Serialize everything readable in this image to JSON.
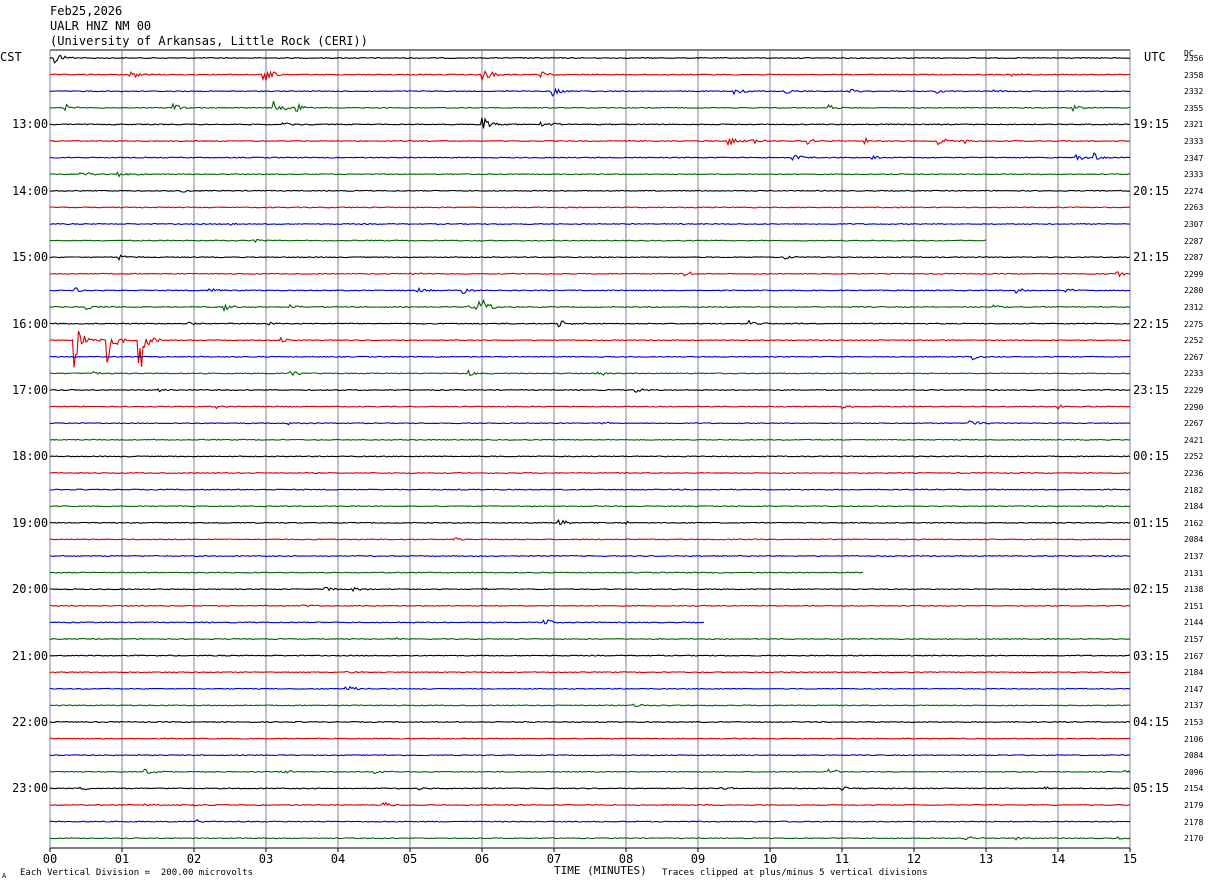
{
  "header": {
    "date": "Feb25,2026",
    "station": "UALR HNZ NM 00",
    "institution": "(University of Arkansas, Little Rock (CERI))"
  },
  "left_zone": "CST",
  "right_zone": "UTC",
  "dc_label": "DC",
  "footer": {
    "left": "Each Vertical Division =  200.00 microvolts",
    "center": "TIME (MINUTES)",
    "right": "Traces clipped at plus/minus 5 vertical divisions",
    "corner": "A"
  },
  "chart_data": {
    "type": "line",
    "title": "UALR HNZ NM 00",
    "xlabel": "TIME (MINUTES)",
    "ylabel": "",
    "xlim": [
      0,
      15
    ],
    "x_ticks": [
      "00",
      "01",
      "02",
      "03",
      "04",
      "05",
      "06",
      "07",
      "08",
      "09",
      "10",
      "11",
      "12",
      "13",
      "14",
      "15"
    ],
    "trace_minutes": 15,
    "trace_colors": [
      "#000000",
      "#d40000",
      "#0000c8",
      "#006400"
    ],
    "grid": true,
    "left_hour_labels": [
      {
        "row": 4,
        "label": "13:00"
      },
      {
        "row": 8,
        "label": "14:00"
      },
      {
        "row": 12,
        "label": "15:00"
      },
      {
        "row": 16,
        "label": "16:00"
      },
      {
        "row": 20,
        "label": "17:00"
      },
      {
        "row": 24,
        "label": "18:00"
      },
      {
        "row": 28,
        "label": "19:00"
      },
      {
        "row": 32,
        "label": "20:00"
      },
      {
        "row": 36,
        "label": "21:00"
      },
      {
        "row": 40,
        "label": "22:00"
      },
      {
        "row": 44,
        "label": "23:00"
      }
    ],
    "right_hour_labels": [
      {
        "row": 4,
        "label": "19:15"
      },
      {
        "row": 8,
        "label": "20:15"
      },
      {
        "row": 12,
        "label": "21:15"
      },
      {
        "row": 16,
        "label": "22:15"
      },
      {
        "row": 20,
        "label": "23:15"
      },
      {
        "row": 24,
        "label": "00:15"
      },
      {
        "row": 28,
        "label": "01:15"
      },
      {
        "row": 32,
        "label": "02:15"
      },
      {
        "row": 36,
        "label": "03:15"
      },
      {
        "row": 40,
        "label": "04:15"
      },
      {
        "row": 44,
        "label": "05:15"
      }
    ],
    "dc_values": [
      2356,
      2358,
      2332,
      2355,
      2321,
      2333,
      2347,
      2333,
      2274,
      2263,
      2307,
      2287,
      2287,
      2299,
      2280,
      2312,
      2275,
      2252,
      2267,
      2233,
      2229,
      2290,
      2267,
      2421,
      2252,
      2236,
      2182,
      2184,
      2162,
      2084,
      2137,
      2131,
      2138,
      2151,
      2144,
      2157,
      2167,
      2184,
      2147,
      2137,
      2153,
      2106,
      2084,
      2096,
      2154,
      2179,
      2178,
      2170
    ],
    "traces": [
      {
        "end": 15,
        "events": [
          {
            "t": 0.05,
            "a": 1.2
          }
        ]
      },
      {
        "end": 15,
        "events": [
          {
            "t": 1.1,
            "a": 0.8
          },
          {
            "t": 2.95,
            "a": 1.8
          },
          {
            "t": 6.0,
            "a": 1.6
          },
          {
            "t": 6.8,
            "a": 1.0
          },
          {
            "t": 13.3,
            "a": 0.6
          }
        ]
      },
      {
        "end": 15,
        "events": [
          {
            "t": 6.95,
            "a": 1.0
          },
          {
            "t": 9.5,
            "a": 0.6
          },
          {
            "t": 10.2,
            "a": 0.6
          },
          {
            "t": 11.1,
            "a": 0.5
          },
          {
            "t": 12.3,
            "a": 0.5
          },
          {
            "t": 13.1,
            "a": 0.4
          }
        ]
      },
      {
        "end": 15,
        "events": [
          {
            "t": 0.2,
            "a": 0.6
          },
          {
            "t": 1.7,
            "a": 0.8
          },
          {
            "t": 3.1,
            "a": 1.4
          },
          {
            "t": 3.4,
            "a": 0.9
          },
          {
            "t": 10.8,
            "a": 0.7
          },
          {
            "t": 14.2,
            "a": 0.6
          }
        ]
      },
      {
        "end": 15,
        "events": [
          {
            "t": 3.2,
            "a": 0.5
          },
          {
            "t": 6.0,
            "a": 1.4
          },
          {
            "t": 6.8,
            "a": 0.5
          },
          {
            "t": 7.0,
            "a": 0.4
          }
        ]
      },
      {
        "end": 15,
        "events": [
          {
            "t": 9.4,
            "a": 1.0
          },
          {
            "t": 9.7,
            "a": 0.8
          },
          {
            "t": 10.5,
            "a": 0.7
          },
          {
            "t": 11.3,
            "a": 0.6
          },
          {
            "t": 12.3,
            "a": 0.9
          },
          {
            "t": 12.7,
            "a": 0.5
          }
        ]
      },
      {
        "end": 15,
        "events": [
          {
            "t": 10.3,
            "a": 0.8
          },
          {
            "t": 11.4,
            "a": 0.6
          },
          {
            "t": 14.2,
            "a": 0.8
          },
          {
            "t": 14.5,
            "a": 0.7
          }
        ]
      },
      {
        "end": 15,
        "events": [
          {
            "t": 0.4,
            "a": 0.7
          },
          {
            "t": 0.9,
            "a": 0.8
          },
          {
            "t": 1.0,
            "a": 0.5
          }
        ]
      },
      {
        "end": 15,
        "events": [
          {
            "t": 1.8,
            "a": 0.4
          }
        ]
      },
      {
        "end": 15,
        "events": []
      },
      {
        "end": 15,
        "events": [
          {
            "t": 2.5,
            "a": 0.2
          }
        ]
      },
      {
        "end": 13.0,
        "events": [
          {
            "t": 2.8,
            "a": 0.4
          }
        ]
      },
      {
        "end": 15,
        "events": [
          {
            "t": 0.95,
            "a": 0.6
          },
          {
            "t": 10.2,
            "a": 0.5
          }
        ]
      },
      {
        "end": 15,
        "events": [
          {
            "t": 5.0,
            "a": 0.3
          },
          {
            "t": 8.8,
            "a": 0.5
          },
          {
            "t": 14.8,
            "a": 0.6
          }
        ]
      },
      {
        "end": 15,
        "events": [
          {
            "t": 0.3,
            "a": 0.6
          },
          {
            "t": 2.2,
            "a": 0.7
          },
          {
            "t": 5.1,
            "a": 0.6
          },
          {
            "t": 5.7,
            "a": 0.8
          },
          {
            "t": 13.4,
            "a": 0.6
          },
          {
            "t": 14.1,
            "a": 0.5
          }
        ]
      },
      {
        "end": 15,
        "events": [
          {
            "t": 0.5,
            "a": 0.5
          },
          {
            "t": 2.4,
            "a": 0.7
          },
          {
            "t": 3.3,
            "a": 0.6
          },
          {
            "t": 5.8,
            "a": 1.0
          },
          {
            "t": 5.95,
            "a": 1.8
          },
          {
            "t": 13.1,
            "a": 0.5
          }
        ]
      },
      {
        "end": 15,
        "events": [
          {
            "t": 1.9,
            "a": 0.5
          },
          {
            "t": 3.0,
            "a": 0.4
          },
          {
            "t": 7.05,
            "a": 0.8
          },
          {
            "t": 9.7,
            "a": 0.9
          }
        ]
      },
      {
        "end": 15,
        "events": [
          {
            "t": 0.35,
            "a": 3.0
          },
          {
            "t": 0.8,
            "a": 2.5
          },
          {
            "t": 1.25,
            "a": 2.5
          },
          {
            "t": 3.2,
            "a": 0.5
          }
        ]
      },
      {
        "end": 15,
        "events": [
          {
            "t": 12.8,
            "a": 0.5
          }
        ]
      },
      {
        "end": 15,
        "events": [
          {
            "t": 0.6,
            "a": 0.5
          },
          {
            "t": 3.3,
            "a": 0.8
          },
          {
            "t": 5.8,
            "a": 0.7
          },
          {
            "t": 7.6,
            "a": 0.6
          }
        ]
      },
      {
        "end": 15,
        "events": [
          {
            "t": 1.5,
            "a": 0.3
          },
          {
            "t": 8.1,
            "a": 0.5
          }
        ]
      },
      {
        "end": 15,
        "events": [
          {
            "t": 2.3,
            "a": 0.3
          },
          {
            "t": 11.0,
            "a": 0.4
          },
          {
            "t": 14.0,
            "a": 0.5
          }
        ]
      },
      {
        "end": 15,
        "events": [
          {
            "t": 3.3,
            "a": 0.4
          },
          {
            "t": 7.6,
            "a": 0.3
          },
          {
            "t": 12.75,
            "a": 0.9
          }
        ]
      },
      {
        "end": 15,
        "events": []
      },
      {
        "end": 15,
        "events": []
      },
      {
        "end": 15,
        "events": []
      },
      {
        "end": 15,
        "events": []
      },
      {
        "end": 15,
        "events": [
          {
            "t": 14.6,
            "a": 0.3
          }
        ]
      },
      {
        "end": 15,
        "events": [
          {
            "t": 7.05,
            "a": 0.7
          },
          {
            "t": 8.0,
            "a": 0.2
          }
        ]
      },
      {
        "end": 15,
        "events": [
          {
            "t": 5.6,
            "a": 0.3
          }
        ]
      },
      {
        "end": 15,
        "events": []
      },
      {
        "end": 11.3,
        "events": []
      },
      {
        "end": 15,
        "events": [
          {
            "t": 3.8,
            "a": 0.5
          },
          {
            "t": 4.2,
            "a": 0.4
          },
          {
            "t": 6.0,
            "a": 0.3
          }
        ]
      },
      {
        "end": 15,
        "events": [
          {
            "t": 3.5,
            "a": 0.2
          }
        ]
      },
      {
        "end": 9.1,
        "events": [
          {
            "t": 6.85,
            "a": 0.7
          }
        ]
      },
      {
        "end": 15,
        "events": [
          {
            "t": 4.8,
            "a": 0.2
          }
        ]
      },
      {
        "end": 15,
        "events": []
      },
      {
        "end": 15,
        "events": [
          {
            "t": 4.1,
            "a": 0.4
          }
        ]
      },
      {
        "end": 15,
        "events": [
          {
            "t": 4.1,
            "a": 0.6
          }
        ]
      },
      {
        "end": 15,
        "events": [
          {
            "t": 8.1,
            "a": 0.3
          }
        ]
      },
      {
        "end": 15,
        "events": [
          {
            "t": 6.6,
            "a": 0.2
          }
        ]
      },
      {
        "end": 15,
        "events": []
      },
      {
        "end": 15,
        "events": []
      },
      {
        "end": 15,
        "events": [
          {
            "t": 1.3,
            "a": 0.6
          },
          {
            "t": 3.2,
            "a": 0.5
          },
          {
            "t": 4.5,
            "a": 0.4
          },
          {
            "t": 10.8,
            "a": 0.6
          },
          {
            "t": 14.9,
            "a": 0.4
          }
        ]
      },
      {
        "end": 15,
        "events": [
          {
            "t": 0.4,
            "a": 0.4
          },
          {
            "t": 5.1,
            "a": 0.3
          },
          {
            "t": 9.3,
            "a": 0.4
          },
          {
            "t": 11.0,
            "a": 0.3
          },
          {
            "t": 13.8,
            "a": 0.3
          }
        ]
      },
      {
        "end": 15,
        "events": [
          {
            "t": 1.3,
            "a": 0.3
          },
          {
            "t": 2.0,
            "a": 0.3
          },
          {
            "t": 4.6,
            "a": 0.6
          }
        ]
      },
      {
        "end": 15,
        "events": [
          {
            "t": 2.0,
            "a": 0.5
          }
        ]
      },
      {
        "end": 15,
        "events": [
          {
            "t": 12.7,
            "a": 0.5
          },
          {
            "t": 13.4,
            "a": 0.4
          },
          {
            "t": 14.8,
            "a": 0.3
          }
        ]
      }
    ]
  }
}
